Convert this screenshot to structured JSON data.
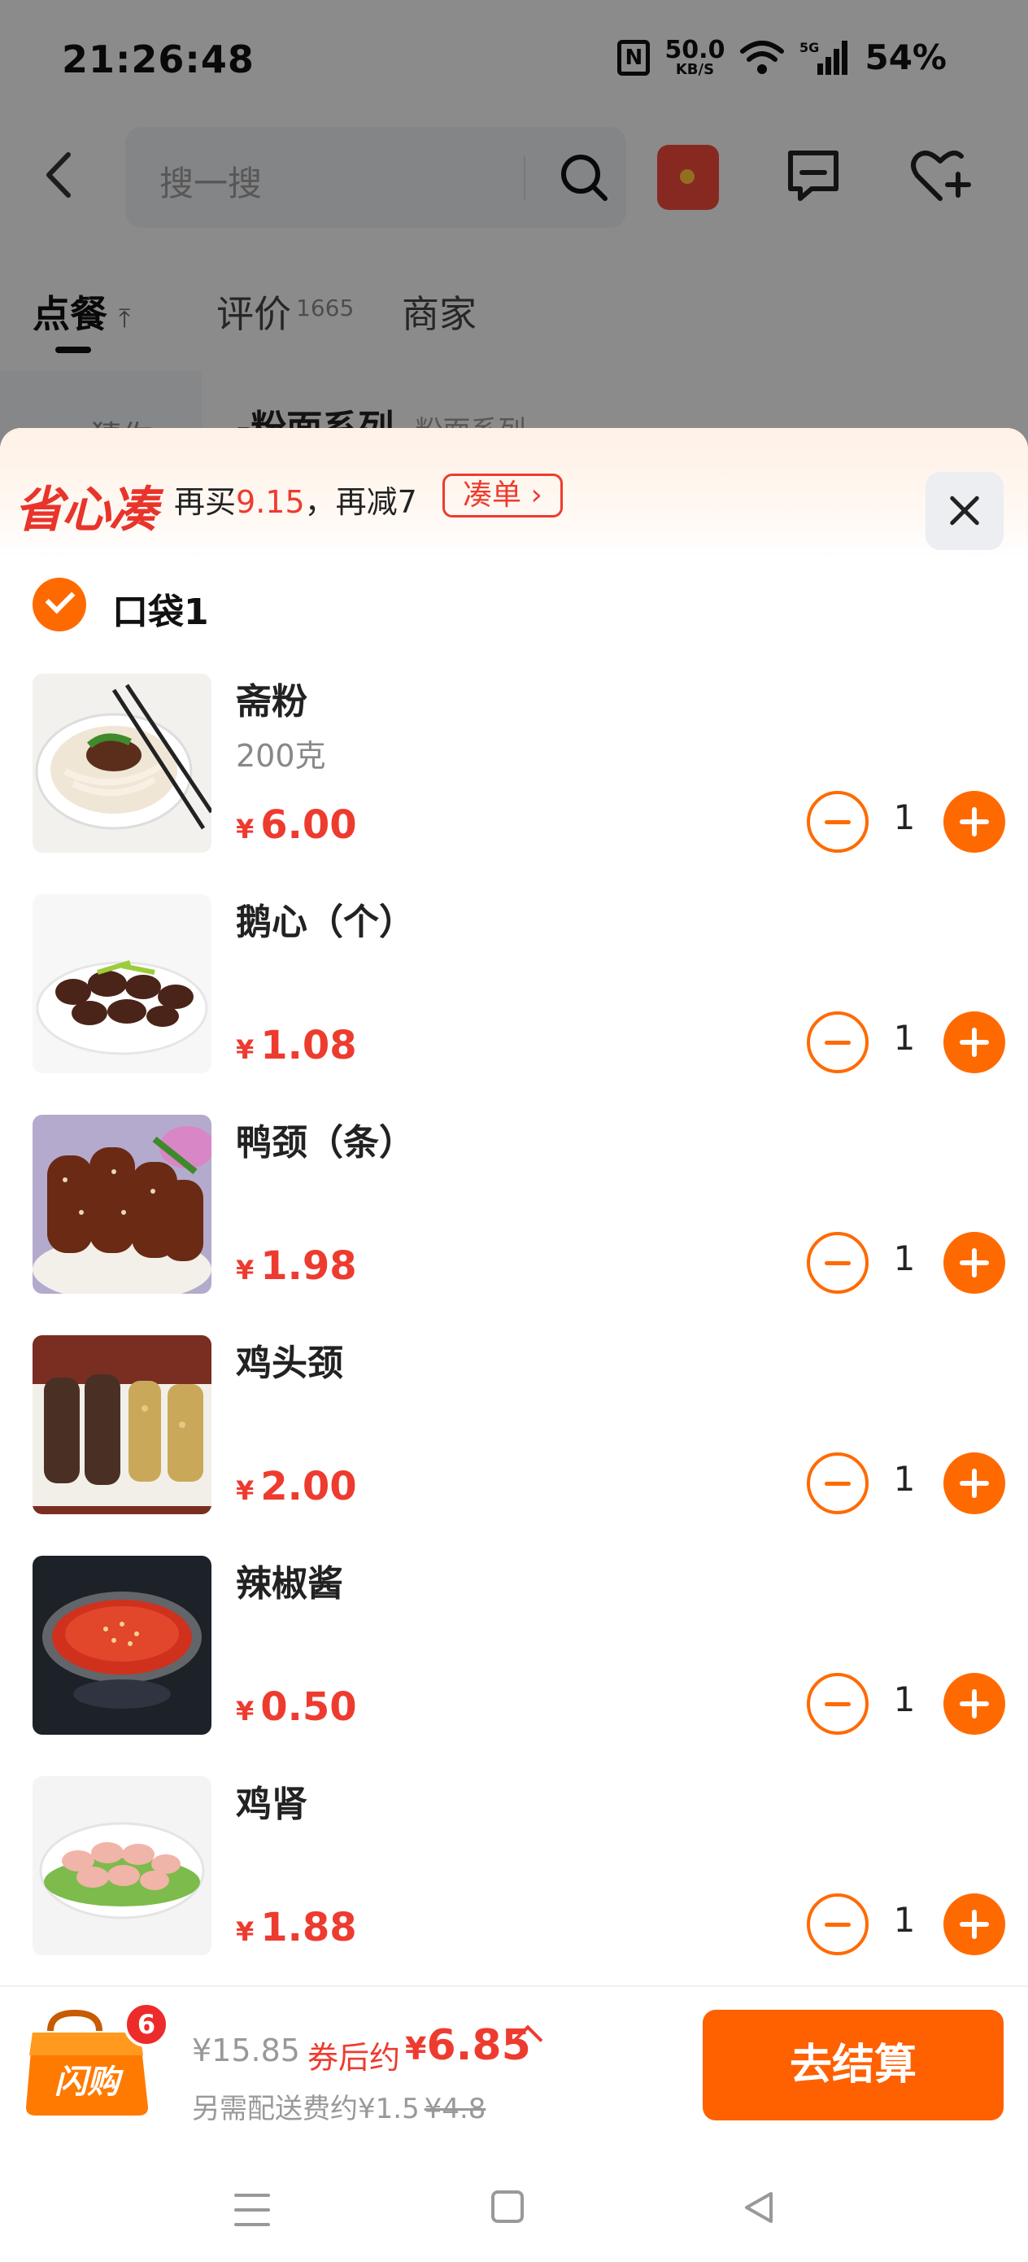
{
  "status_bar": {
    "time": "21:26:48",
    "nfc_icon": "nfc-icon",
    "net_speed_value": "50.0",
    "net_speed_unit": "KB/S",
    "wifi_icon": "wifi-icon",
    "signal_label": "5G",
    "battery": "54%"
  },
  "header": {
    "search_placeholder": "搜一搜"
  },
  "tabs": [
    {
      "label": "点餐",
      "active": true
    },
    {
      "label": "评价",
      "count": "1665"
    },
    {
      "label": "商家"
    }
  ],
  "background": {
    "side_item": "猜你",
    "section_title": "-粉面系列",
    "section_subtitle": "-粉面系列"
  },
  "promo": {
    "logo": "省心凑",
    "text_prefix": "再买",
    "amount": "9.15",
    "text_suffix": "，再减7",
    "button": "凑单 ›"
  },
  "bag": {
    "label": "口袋1",
    "checked": true
  },
  "items": [
    {
      "name": "斋粉",
      "spec": "200克",
      "currency": "¥",
      "price": "6.00",
      "qty": "1"
    },
    {
      "name": "鹅心（个）",
      "spec": "",
      "currency": "¥",
      "price": "1.08",
      "qty": "1"
    },
    {
      "name": "鸭颈（条）",
      "spec": "",
      "currency": "¥",
      "price": "1.98",
      "qty": "1"
    },
    {
      "name": "鸡头颈",
      "spec": "",
      "currency": "¥",
      "price": "2.00",
      "qty": "1"
    },
    {
      "name": "辣椒酱",
      "spec": "",
      "currency": "¥",
      "price": "0.50",
      "qty": "1"
    },
    {
      "name": "鸡肾",
      "spec": "",
      "currency": "¥",
      "price": "1.88",
      "qty": "1"
    }
  ],
  "checkout": {
    "bag_icon_text": "闪购",
    "badge_count": "6",
    "original_total": "¥15.85",
    "after_coupon_label": "券后约",
    "currency": "¥",
    "after_coupon_price": "6.85",
    "delivery_text": "另需配送费约¥1.5",
    "delivery_original": "¥4.8",
    "button": "去结算"
  },
  "colors": {
    "accent": "#ff6a00",
    "price_red": "#ee3b2f",
    "checkout_button": "#ff6000"
  }
}
